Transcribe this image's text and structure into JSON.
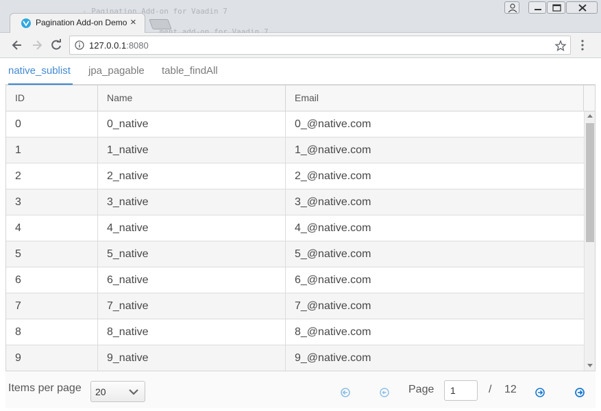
{
  "browser": {
    "background_code_lines": [
      "- Pagination Add-on for Vaadin 7",
      "                 ment add-on for Vaadin 7."
    ],
    "tab_title": "Pagination Add-on Demo",
    "tab_close": "×",
    "url_host": "127.0.0.1",
    "url_port": ":8080"
  },
  "tabsheet": {
    "tabs": [
      {
        "label": "native_sublist",
        "selected": true
      },
      {
        "label": "jpa_pagable",
        "selected": false
      },
      {
        "label": "table_findAll",
        "selected": false
      }
    ]
  },
  "grid": {
    "columns": [
      "ID",
      "Name",
      "Email"
    ],
    "rows": [
      {
        "id": "0",
        "name": "0_native",
        "email": "0_@native.com"
      },
      {
        "id": "1",
        "name": "1_native",
        "email": "1_@native.com"
      },
      {
        "id": "2",
        "name": "2_native",
        "email": "2_@native.com"
      },
      {
        "id": "3",
        "name": "3_native",
        "email": "3_@native.com"
      },
      {
        "id": "4",
        "name": "4_native",
        "email": "4_@native.com"
      },
      {
        "id": "5",
        "name": "5_native",
        "email": "5_@native.com"
      },
      {
        "id": "6",
        "name": "6_native",
        "email": "6_@native.com"
      },
      {
        "id": "7",
        "name": "7_native",
        "email": "7_@native.com"
      },
      {
        "id": "8",
        "name": "8_native",
        "email": "8_@native.com"
      },
      {
        "id": "9",
        "name": "9_native",
        "email": "9_@native.com"
      }
    ]
  },
  "pager": {
    "items_per_page_label": "Items per page",
    "items_per_page_value": "20",
    "page_label": "Page",
    "current_page": "1",
    "separator": "/",
    "total_pages": "12"
  },
  "icons": {
    "first": "first-page-icon",
    "previous": "previous-page-icon",
    "next": "next-page-icon",
    "last": "last-page-icon"
  },
  "colors": {
    "accent": "#3b86d5",
    "pager_icon_active": "#1a7ad4",
    "pager_icon_disabled": "#8cbde6"
  }
}
